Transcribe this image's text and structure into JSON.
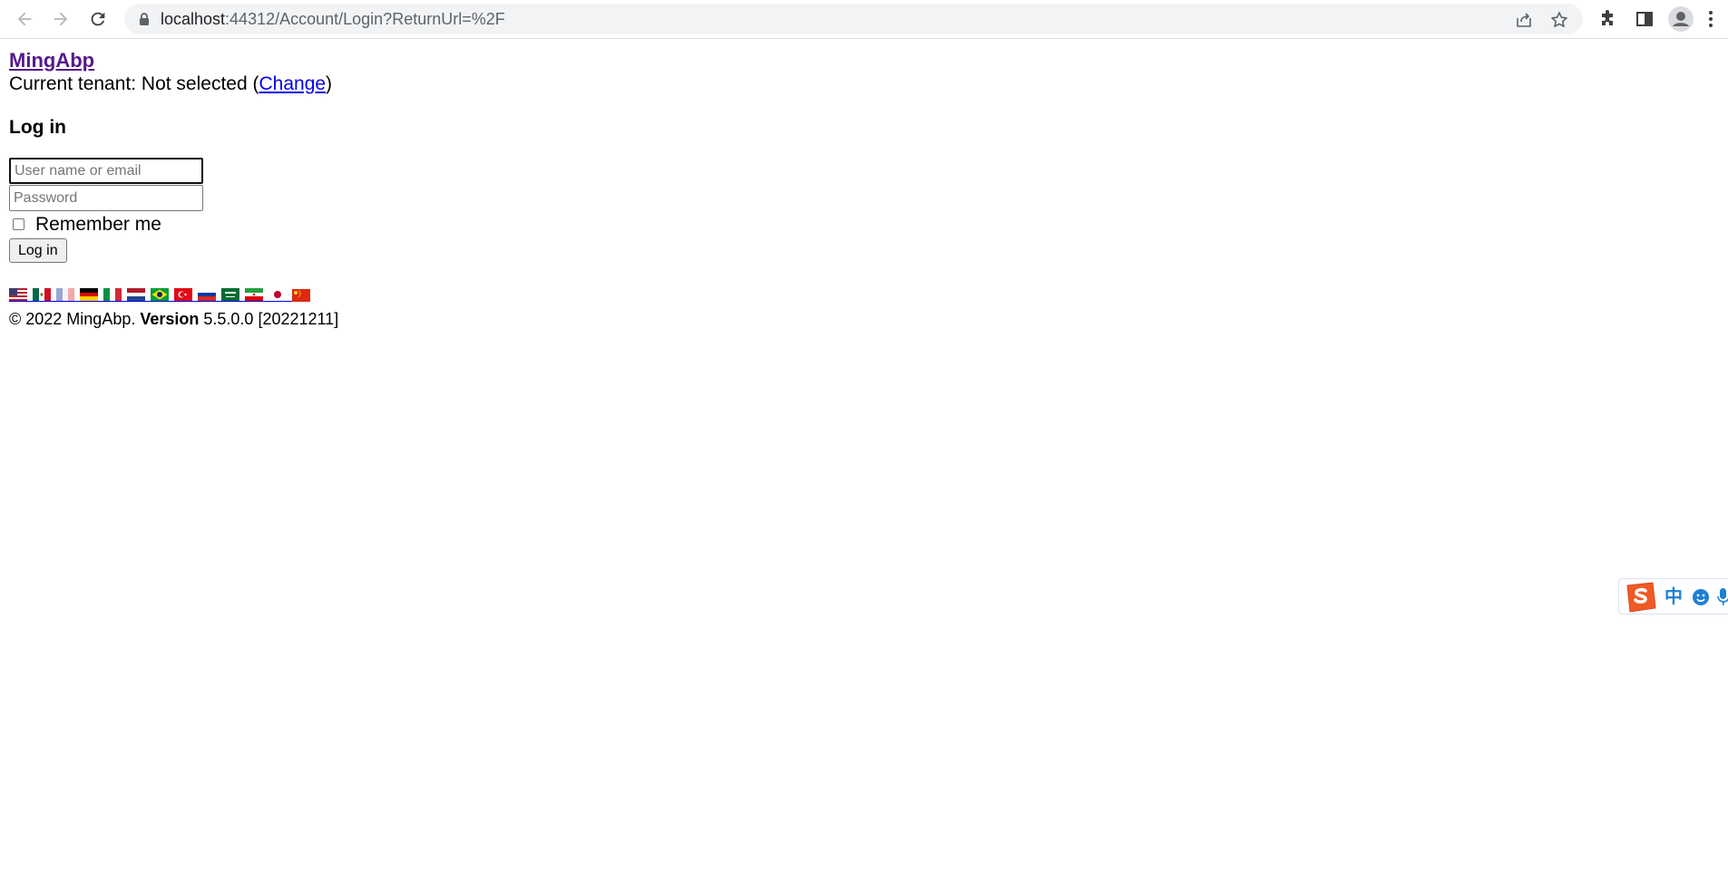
{
  "browser": {
    "url_host": "localhost",
    "url_path": ":44312/Account/Login?ReturnUrl=%2F",
    "icons": {
      "back": "back-arrow-icon",
      "forward": "forward-arrow-icon",
      "reload": "reload-icon",
      "lock": "lock-icon",
      "share": "share-icon",
      "bookmark": "star-icon",
      "extensions": "puzzle-icon",
      "side_panel": "side-panel-icon",
      "profile": "profile-icon",
      "menu": "kebab-menu-icon"
    }
  },
  "app": {
    "brand": "MingAbp",
    "tenant_prefix": "Current tenant: Not selected (",
    "tenant_change": "Change",
    "tenant_suffix": ")"
  },
  "login": {
    "title": "Log in",
    "username_placeholder": "User name or email",
    "password_placeholder": "Password",
    "remember_label": "Remember me",
    "remember_checked": false,
    "submit_label": "Log in"
  },
  "languages": [
    {
      "code": "en",
      "flag": "flag-us-icon"
    },
    {
      "code": "es-MX",
      "flag": "flag-mx-icon"
    },
    {
      "code": "fr",
      "flag": "flag-fr-icon"
    },
    {
      "code": "de",
      "flag": "flag-de-icon"
    },
    {
      "code": "it",
      "flag": "flag-it-icon"
    },
    {
      "code": "nl",
      "flag": "flag-nl-icon"
    },
    {
      "code": "pt-BR",
      "flag": "flag-br-icon"
    },
    {
      "code": "tr",
      "flag": "flag-tr-icon"
    },
    {
      "code": "ru",
      "flag": "flag-ru-icon"
    },
    {
      "code": "ar",
      "flag": "flag-sa-icon"
    },
    {
      "code": "fa",
      "flag": "flag-ir-icon"
    },
    {
      "code": "ja",
      "flag": "flag-jp-icon"
    },
    {
      "code": "zh-Hans",
      "flag": "flag-cn-icon"
    }
  ],
  "footer": {
    "copyright": "© 2022 MingAbp. ",
    "version_label": "Version",
    "version_value": " 5.5.0.0 [20221211]"
  },
  "ime": {
    "lang": "中",
    "icons": [
      "sogou-logo-icon",
      "emoji-icon",
      "microphone-icon"
    ],
    "accent": "#1f7fd6",
    "logo_color": "#f05a24"
  }
}
